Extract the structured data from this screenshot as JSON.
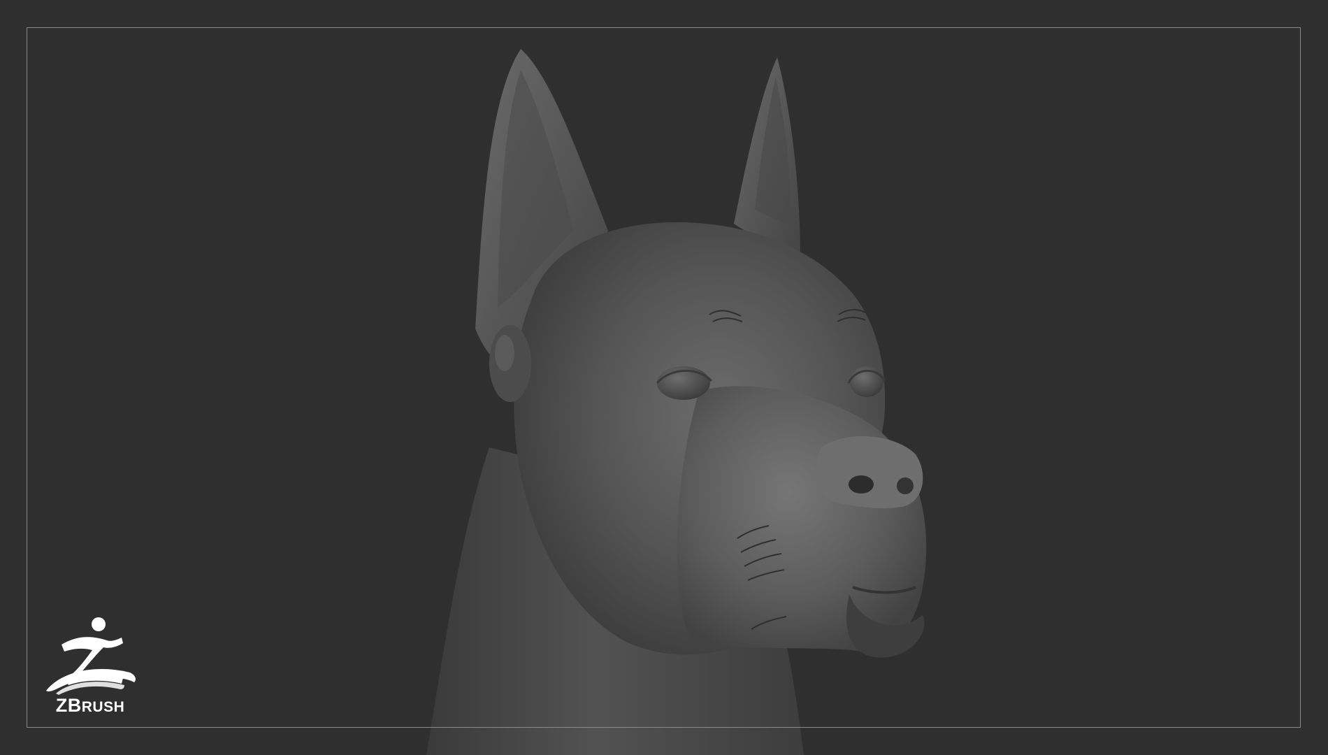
{
  "viewport": {
    "background_color": "#2f2f2f",
    "frame_color": "#8a8a8a",
    "subject": "sculpted-dog-head-clay-render"
  },
  "logo": {
    "icon": "zbrush-running-figure-icon",
    "word_prefix": "ZB",
    "word_suffix": "RUSH",
    "color": "#ffffff"
  }
}
